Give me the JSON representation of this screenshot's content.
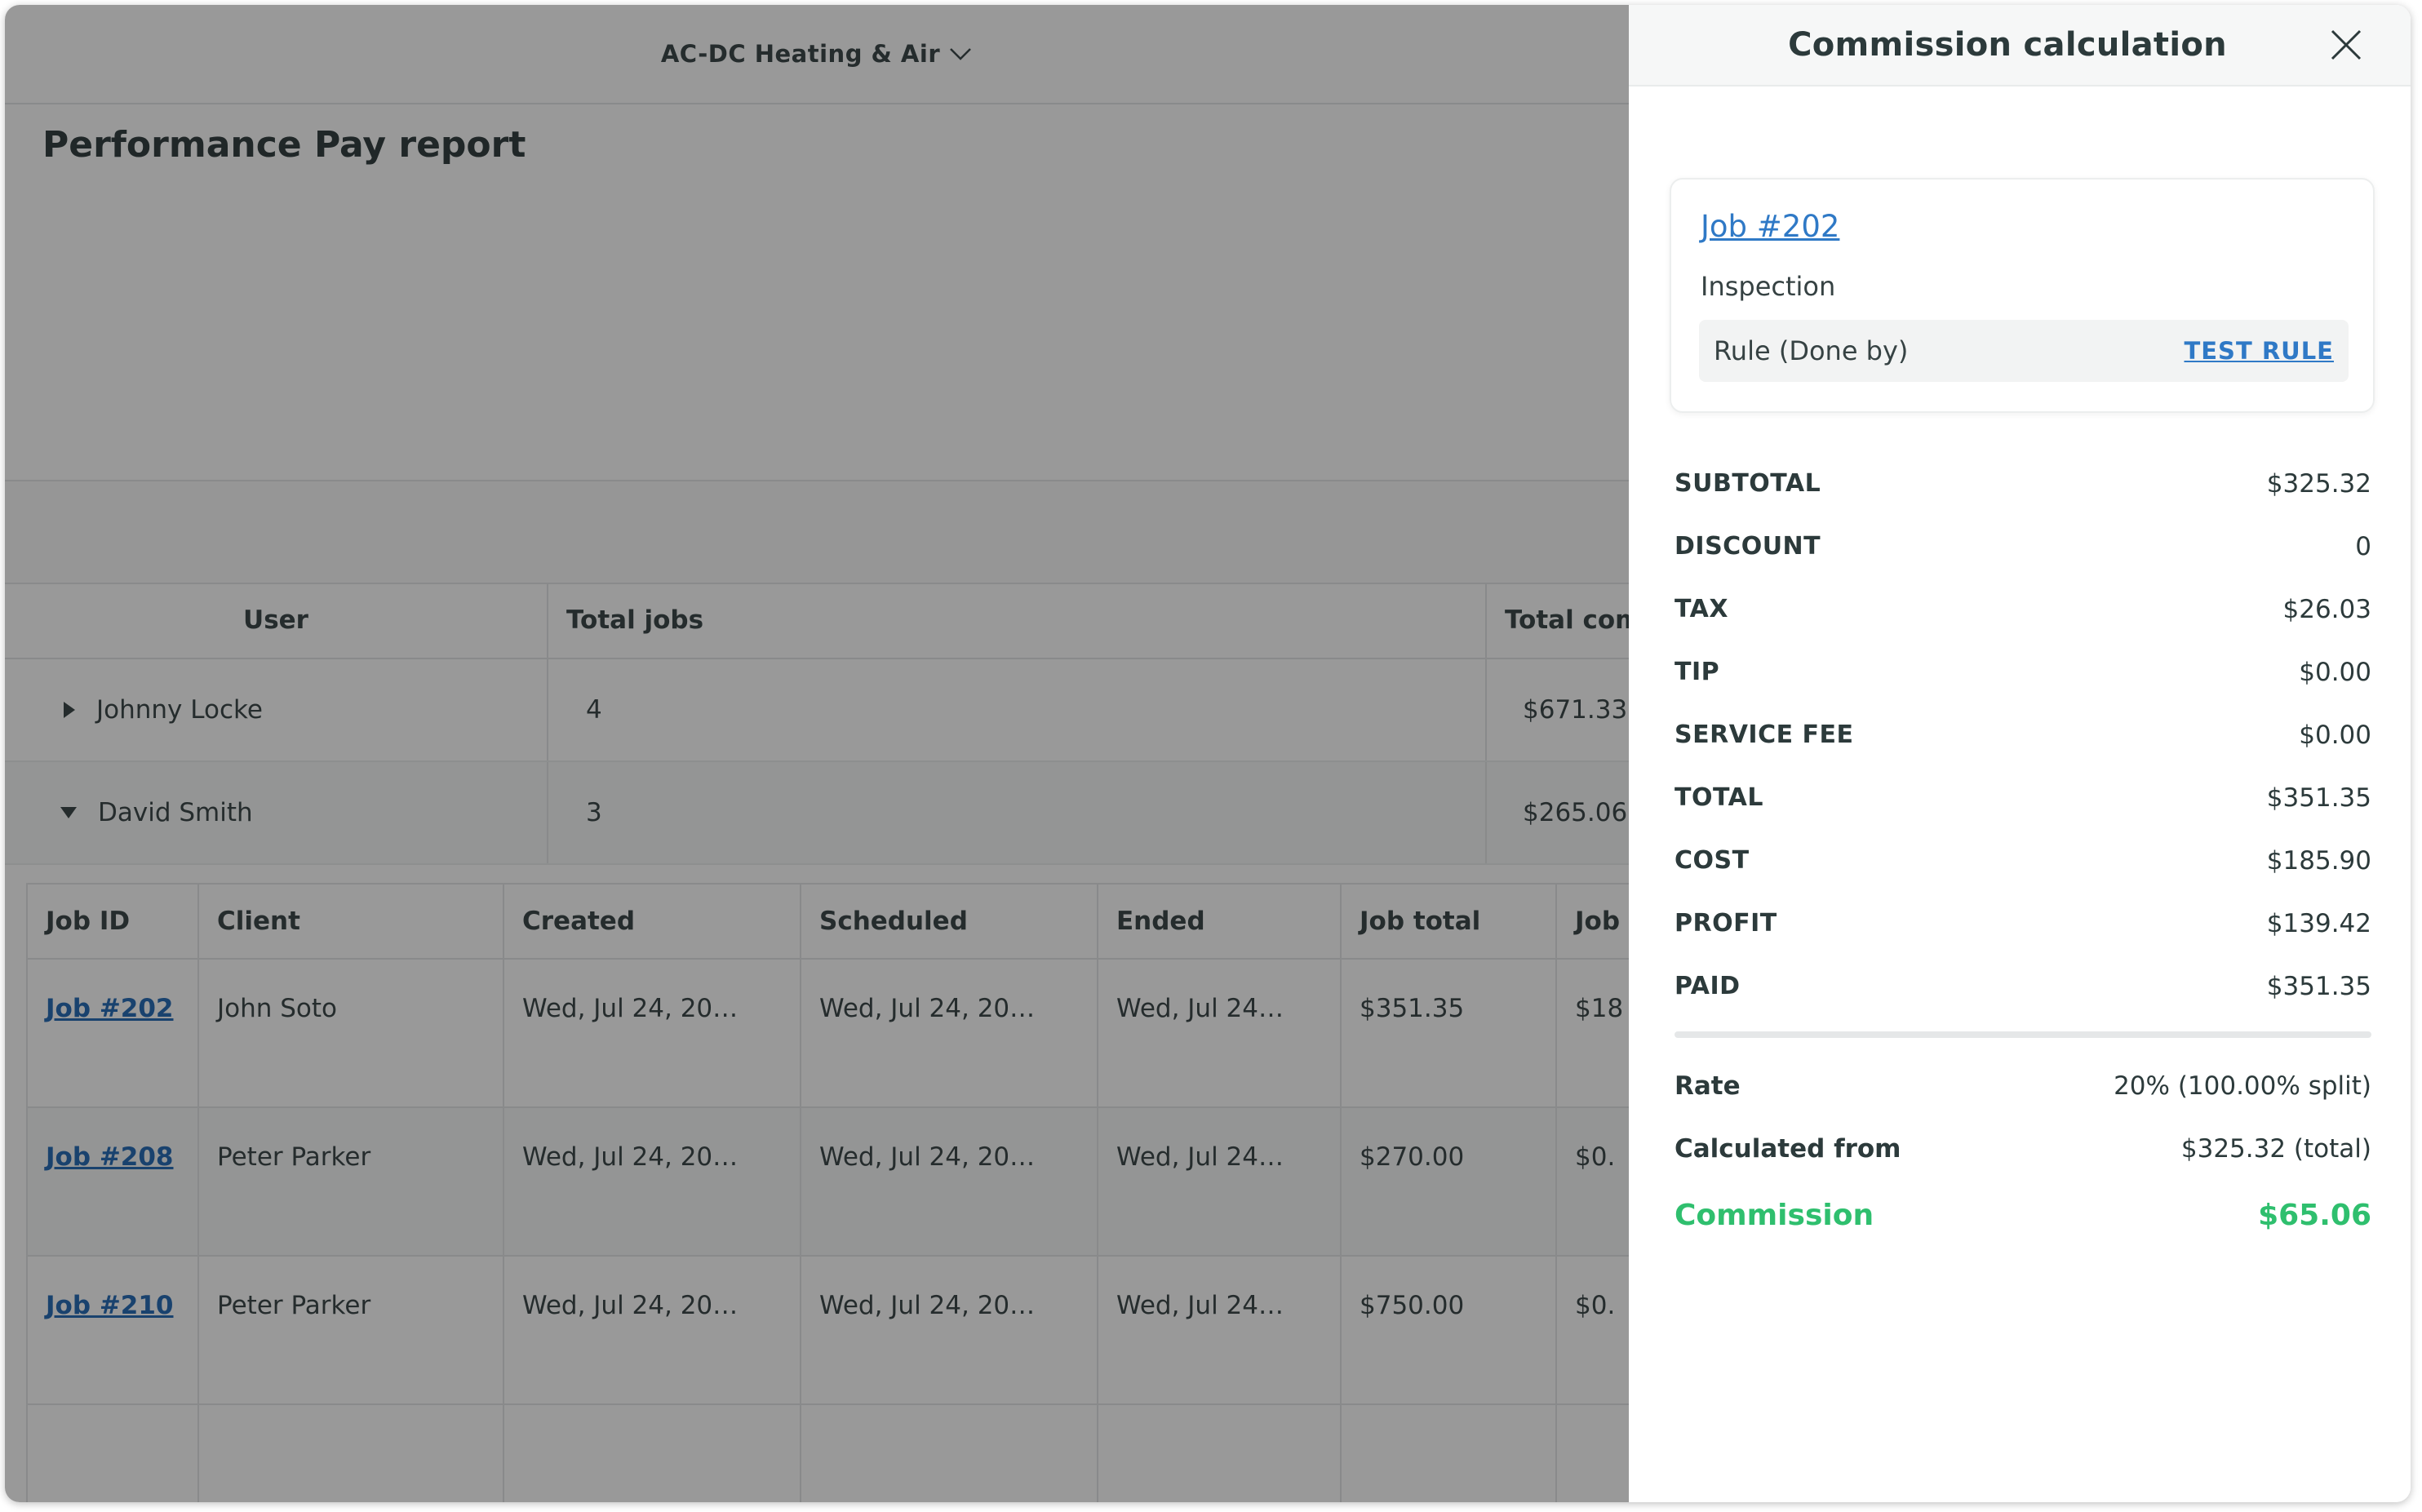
{
  "topbar": {
    "company_name": "AC-DC Heating & Air"
  },
  "page": {
    "title": "Performance Pay report"
  },
  "users_table": {
    "headers": [
      "User",
      "Total jobs",
      "Total com"
    ],
    "rows": [
      {
        "name": "Johnny Locke",
        "total_jobs": "4",
        "total_commission": "$671.33",
        "expanded": false
      },
      {
        "name": "David Smith",
        "total_jobs": "3",
        "total_commission": "$265.06",
        "expanded": true
      }
    ]
  },
  "jobs_table": {
    "headers": [
      "Job ID",
      "Client",
      "Created",
      "Scheduled",
      "Ended",
      "Job total",
      "Job"
    ],
    "rows": [
      {
        "job_id": "Job #202",
        "client": "John Soto",
        "created": "Wed, Jul 24, 20…",
        "scheduled": "Wed, Jul 24, 20…",
        "ended": "Wed, Jul 24…",
        "job_total": "$351.35",
        "job_cost": "$18"
      },
      {
        "job_id": "Job #208",
        "client": "Peter Parker",
        "created": "Wed, Jul 24, 20…",
        "scheduled": "Wed, Jul 24, 20…",
        "ended": "Wed, Jul 24…",
        "job_total": "$270.00",
        "job_cost": "$0."
      },
      {
        "job_id": "Job #210",
        "client": "Peter Parker",
        "created": "Wed, Jul 24, 20…",
        "scheduled": "Wed, Jul 24, 20…",
        "ended": "Wed, Jul 24…",
        "job_total": "$750.00",
        "job_cost": "$0."
      }
    ]
  },
  "drawer": {
    "title": "Commission calculation",
    "close_icon": "close-icon",
    "job": {
      "link": "Job #202",
      "type": "Inspection",
      "rule": "Rule (Done by)",
      "test_rule": "TEST RULE"
    },
    "summary": [
      {
        "label": "SUBTOTAL",
        "value": "$325.32"
      },
      {
        "label": "DISCOUNT",
        "value": "0"
      },
      {
        "label": "TAX",
        "value": "$26.03"
      },
      {
        "label": "TIP",
        "value": "$0.00"
      },
      {
        "label": "SERVICE FEE",
        "value": "$0.00"
      },
      {
        "label": "TOTAL",
        "value": "$351.35"
      },
      {
        "label": "COST",
        "value": "$185.90"
      },
      {
        "label": "PROFIT",
        "value": "$139.42"
      },
      {
        "label": "PAID",
        "value": "$351.35"
      }
    ],
    "rate": {
      "label": "Rate",
      "value": "20% (100.00% split)"
    },
    "calculated_from": {
      "label": "Calculated from",
      "value": "$325.32 (total)"
    },
    "commission": {
      "label": "Commission",
      "value": "$65.06"
    }
  },
  "colors": {
    "link": "#2f79c6",
    "commission_green": "#2fbf6e",
    "overlay": "rgba(0,0,0,0.40)",
    "text_dark": "#2c3a3b"
  }
}
